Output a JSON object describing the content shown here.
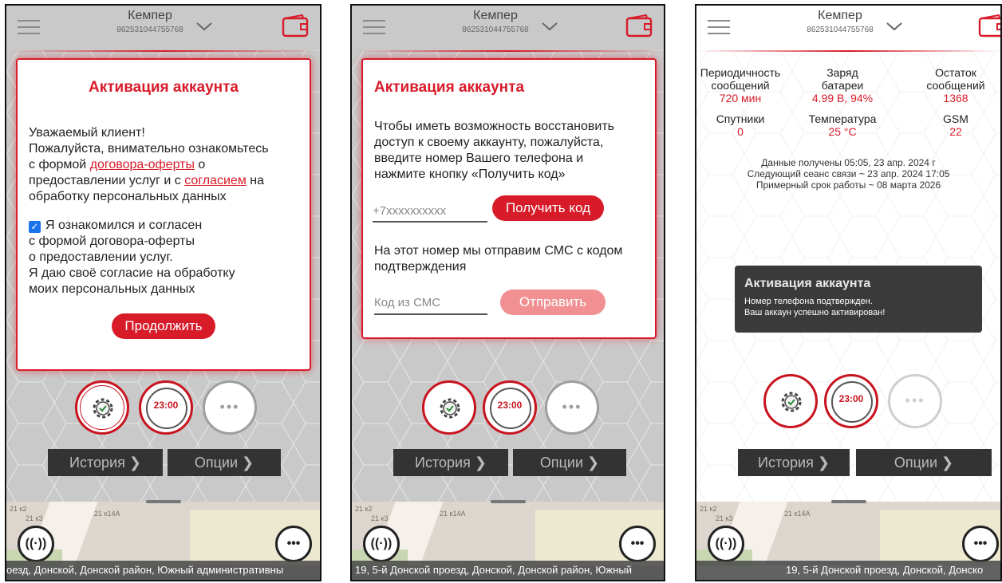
{
  "header": {
    "device_name": "Кемпер",
    "device_id": "862531044755768"
  },
  "screen1": {
    "title": "Активация аккаунта",
    "p1": "Уважаемый клиент!",
    "p2": "Пожалуйста, внимательно ознакомьтесь",
    "p3a": "с формой ",
    "link1": "договора-оферты",
    "p3b": " о",
    "p4a": "предоставлении услуг и с ",
    "link2": "согласием",
    "p4b": " на",
    "p5": "обработку персональных данных",
    "c1": "Я ознакомился и согласен",
    "c2": "с формой договора-оферты",
    "c3": "о предоставлении услуг.",
    "c4": "Я даю своё согласие на обработку",
    "c5": "моих персональных данных",
    "continue_btn": "Продолжить",
    "checkbox_checked": true
  },
  "screen2": {
    "title": "Активация аккаунта",
    "l1": "Чтобы иметь возможность восстановить",
    "l2": "доступ к своему аккаунту, пожалуйста,",
    "l3": "введите номер Вашего телефона и",
    "l4": "нажмите кнопку «Получить код»",
    "phone_placeholder": "+7xxxxxxxxxx",
    "get_code_btn": "Получить код",
    "m1": "На этот номер мы отправим СМС с кодом",
    "m2": "подтверждения",
    "sms_placeholder": "Код из СМС",
    "send_btn": "Отправить"
  },
  "screen3": {
    "stats": [
      {
        "label1": "Периодичность",
        "label2": "сообщений",
        "value": "720 мин"
      },
      {
        "label1": "Заряд",
        "label2": "батареи",
        "value": "4.99 В, 94%"
      },
      {
        "label1": "Остаток",
        "label2": "сообщений",
        "value": "1368"
      },
      {
        "label1": "Спутники",
        "label2": "",
        "value": "0"
      },
      {
        "label1": "Температура",
        "label2": "",
        "value": "25 °С"
      },
      {
        "label1": "GSM",
        "label2": "",
        "value": "22"
      }
    ],
    "info1": "Данные получены 05:05, 23 апр. 2024 г",
    "info2": "Следующий сеанс связи ~ 23 апр. 2024 17:05",
    "info3": "Примерный срок работы ~ 08 марта 2026",
    "toast_title": "Активация аккаунта",
    "toast_l1": "Номер телефона подтвержден.",
    "toast_l2": "Ваш аккаун успешно активирован!"
  },
  "controls": {
    "time": "23:00",
    "more_dots": "•••",
    "history": "История ❯",
    "options": "Опции ❯"
  },
  "map": {
    "labels": [
      "21 к2",
      "21 к3",
      "21 к14А"
    ],
    "addr1": "оезд, Донской, Донской район, Южный административны",
    "addr2": "19, 5-й Донской проезд, Донской, Донской район, Южный",
    "addr3": "19, 5-й Донской проезд, Донской, Донско"
  },
  "colors": {
    "accent": "#d81b29",
    "dark": "#333333",
    "disabled": "#f09092"
  }
}
